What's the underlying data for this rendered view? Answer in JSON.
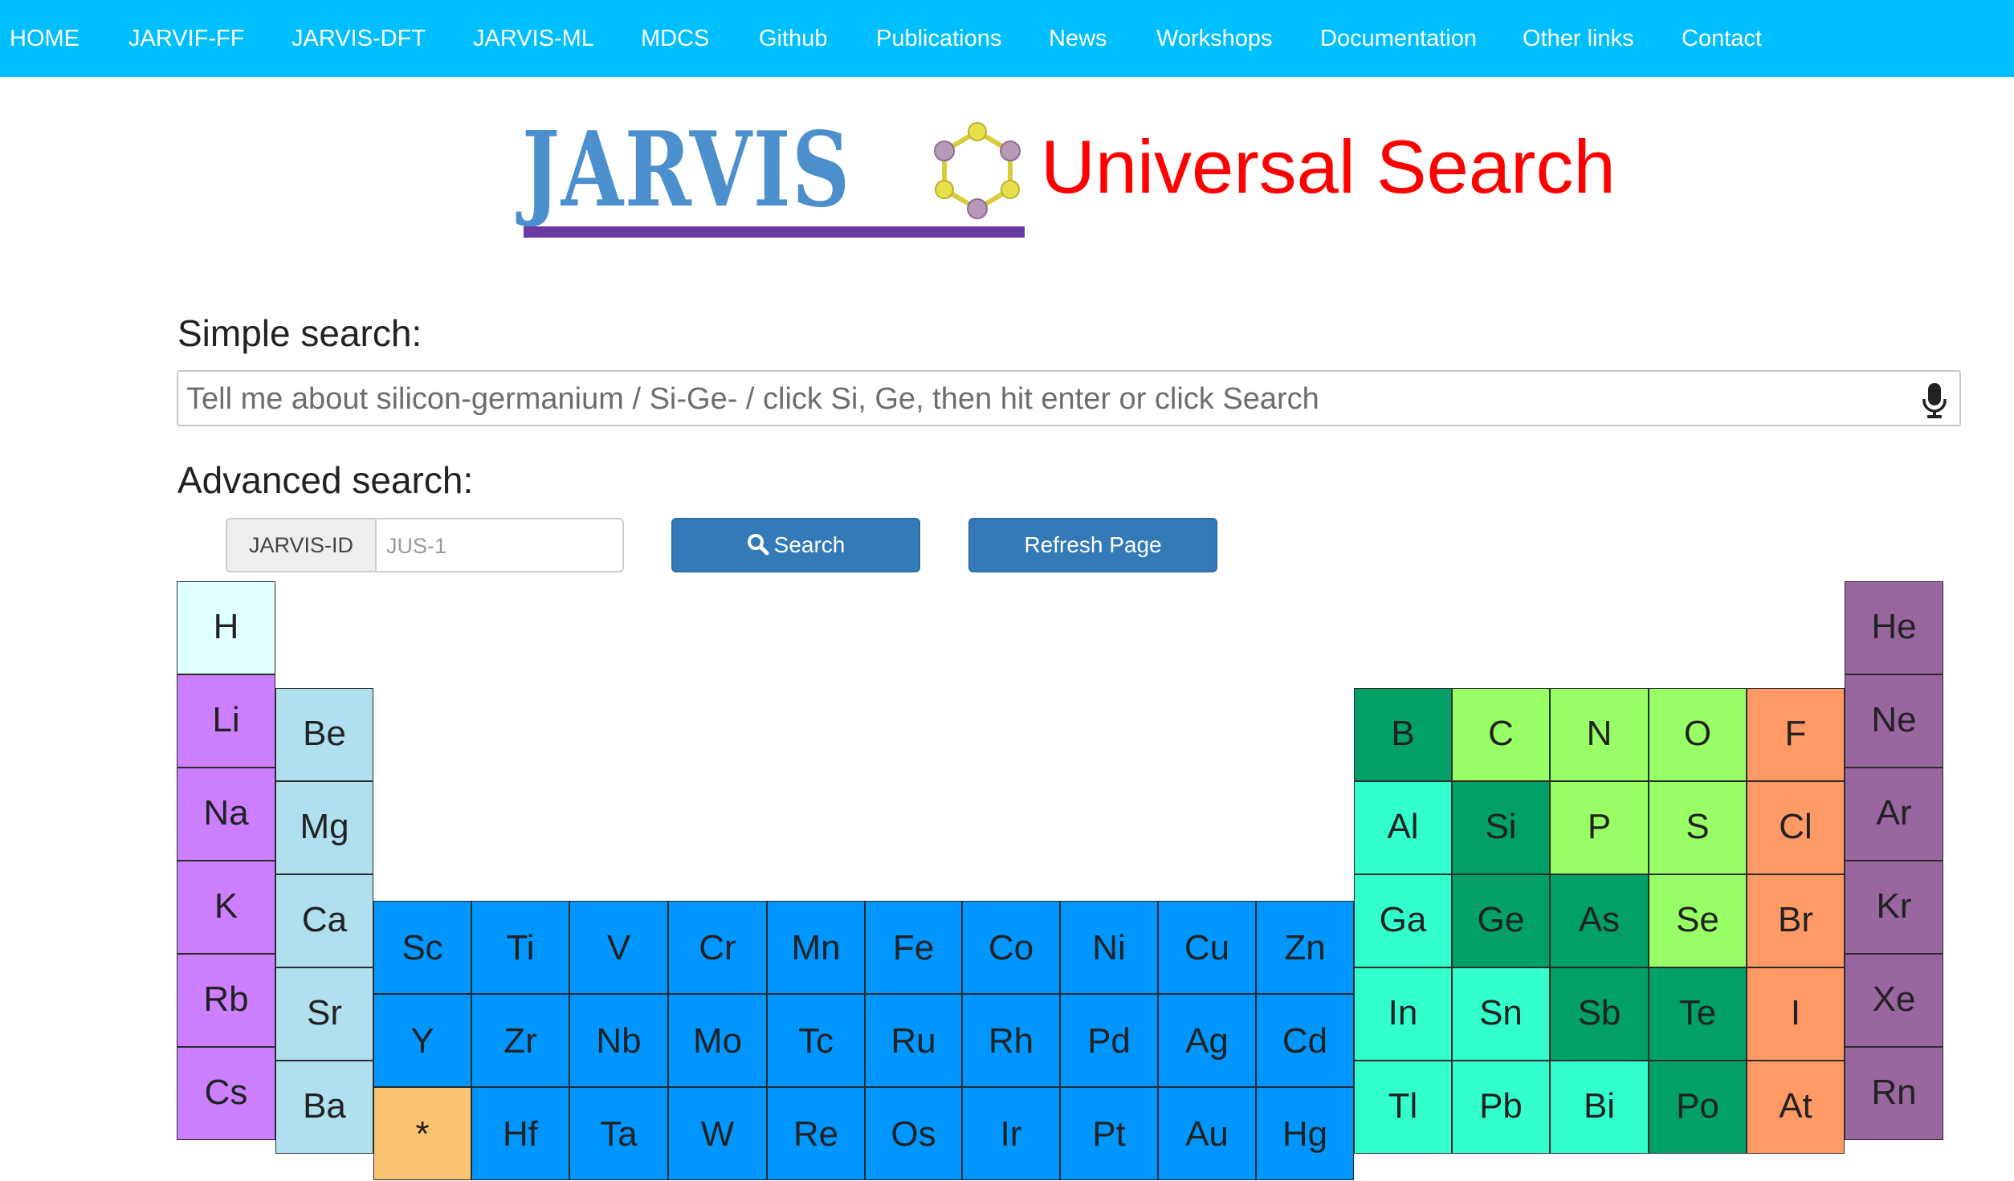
{
  "nav": {
    "items": [
      "HOME",
      "JARVIF-FF",
      "JARVIS-DFT",
      "JARVIS-ML",
      "MDCS",
      "Github",
      "Publications",
      "News",
      "Workshops",
      "Documentation",
      "Other links",
      "Contact"
    ]
  },
  "header": {
    "logo_text": "JARVIS",
    "title": "Universal Search"
  },
  "simple_search": {
    "label": "Simple search:",
    "placeholder": "Tell me about silicon-germanium / Si-Ge- / click Si, Ge, then hit enter or click Search",
    "value": ""
  },
  "advanced_search": {
    "label": "Advanced search:",
    "id_addon": "JARVIS-ID",
    "id_placeholder": "JUS-1",
    "search_label": "Search",
    "refresh_label": "Refresh Page"
  },
  "colors": {
    "nav": "#00bfff",
    "title": "#ff0000",
    "button": "#337ab7",
    "nonmetal_h": "#e0ffff",
    "alkali": "#cc80ff",
    "alkaline_earth": "#b0e0f0",
    "transition": "#0096ff",
    "lanthanide_marker": "#f8c471",
    "metalloid": "#00a066",
    "nonmetal": "#99ff66",
    "post_transition": "#33ffcc",
    "halogen": "#ff9966",
    "noble_gas": "#9966a0"
  },
  "periodic_table": [
    {
      "symbol": "H",
      "category": "nonmetal_h"
    },
    {
      "symbol": "He",
      "category": "noble_gas"
    },
    {
      "symbol": "Li",
      "category": "alkali"
    },
    {
      "symbol": "Be",
      "category": "alkaline_earth"
    },
    {
      "symbol": "B",
      "category": "metalloid"
    },
    {
      "symbol": "C",
      "category": "nonmetal"
    },
    {
      "symbol": "N",
      "category": "nonmetal"
    },
    {
      "symbol": "O",
      "category": "nonmetal"
    },
    {
      "symbol": "F",
      "category": "halogen"
    },
    {
      "symbol": "Ne",
      "category": "noble_gas"
    },
    {
      "symbol": "Na",
      "category": "alkali"
    },
    {
      "symbol": "Mg",
      "category": "alkaline_earth"
    },
    {
      "symbol": "Al",
      "category": "post_transition"
    },
    {
      "symbol": "Si",
      "category": "metalloid"
    },
    {
      "symbol": "P",
      "category": "nonmetal"
    },
    {
      "symbol": "S",
      "category": "nonmetal"
    },
    {
      "symbol": "Cl",
      "category": "halogen"
    },
    {
      "symbol": "Ar",
      "category": "noble_gas"
    },
    {
      "symbol": "K",
      "category": "alkali"
    },
    {
      "symbol": "Ca",
      "category": "alkaline_earth"
    },
    {
      "symbol": "Sc",
      "category": "transition"
    },
    {
      "symbol": "Ti",
      "category": "transition"
    },
    {
      "symbol": "V",
      "category": "transition"
    },
    {
      "symbol": "Cr",
      "category": "transition"
    },
    {
      "symbol": "Mn",
      "category": "transition"
    },
    {
      "symbol": "Fe",
      "category": "transition"
    },
    {
      "symbol": "Co",
      "category": "transition"
    },
    {
      "symbol": "Ni",
      "category": "transition"
    },
    {
      "symbol": "Cu",
      "category": "transition"
    },
    {
      "symbol": "Zn",
      "category": "transition"
    },
    {
      "symbol": "Ga",
      "category": "post_transition"
    },
    {
      "symbol": "Ge",
      "category": "metalloid"
    },
    {
      "symbol": "As",
      "category": "metalloid"
    },
    {
      "symbol": "Se",
      "category": "nonmetal"
    },
    {
      "symbol": "Br",
      "category": "halogen"
    },
    {
      "symbol": "Kr",
      "category": "noble_gas"
    },
    {
      "symbol": "Rb",
      "category": "alkali"
    },
    {
      "symbol": "Sr",
      "category": "alkaline_earth"
    },
    {
      "symbol": "Y",
      "category": "transition"
    },
    {
      "symbol": "Zr",
      "category": "transition"
    },
    {
      "symbol": "Nb",
      "category": "transition"
    },
    {
      "symbol": "Mo",
      "category": "transition"
    },
    {
      "symbol": "Tc",
      "category": "transition"
    },
    {
      "symbol": "Ru",
      "category": "transition"
    },
    {
      "symbol": "Rh",
      "category": "transition"
    },
    {
      "symbol": "Pd",
      "category": "transition"
    },
    {
      "symbol": "Ag",
      "category": "transition"
    },
    {
      "symbol": "Cd",
      "category": "transition"
    },
    {
      "symbol": "In",
      "category": "post_transition"
    },
    {
      "symbol": "Sn",
      "category": "post_transition"
    },
    {
      "symbol": "Sb",
      "category": "metalloid"
    },
    {
      "symbol": "Te",
      "category": "metalloid"
    },
    {
      "symbol": "I",
      "category": "halogen"
    },
    {
      "symbol": "Xe",
      "category": "noble_gas"
    },
    {
      "symbol": "Cs",
      "category": "alkali"
    },
    {
      "symbol": "Ba",
      "category": "alkaline_earth"
    },
    {
      "symbol": "*",
      "category": "lanthanide_marker"
    },
    {
      "symbol": "Hf",
      "category": "transition"
    },
    {
      "symbol": "Ta",
      "category": "transition"
    },
    {
      "symbol": "W",
      "category": "transition"
    },
    {
      "symbol": "Re",
      "category": "transition"
    },
    {
      "symbol": "Os",
      "category": "transition"
    },
    {
      "symbol": "Ir",
      "category": "transition"
    },
    {
      "symbol": "Pt",
      "category": "transition"
    },
    {
      "symbol": "Au",
      "category": "transition"
    },
    {
      "symbol": "Hg",
      "category": "transition"
    },
    {
      "symbol": "Tl",
      "category": "post_transition"
    },
    {
      "symbol": "Pb",
      "category": "post_transition"
    },
    {
      "symbol": "Bi",
      "category": "post_transition"
    },
    {
      "symbol": "Po",
      "category": "metalloid"
    },
    {
      "symbol": "At",
      "category": "halogen"
    },
    {
      "symbol": "Rn",
      "category": "noble_gas"
    }
  ]
}
